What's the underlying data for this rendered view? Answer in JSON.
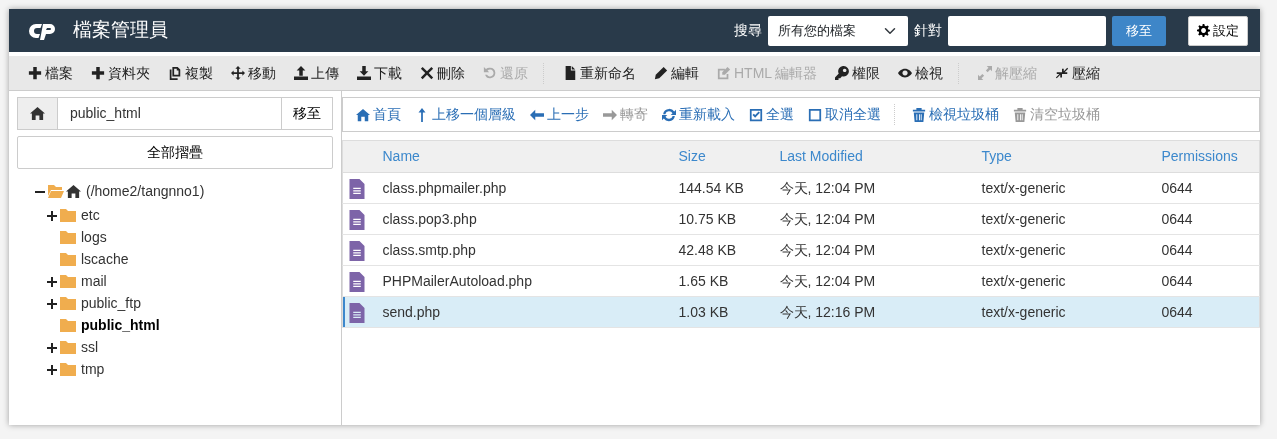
{
  "header": {
    "title": "檔案管理員",
    "search_label": "搜尋",
    "search_scope": "所有您的檔案",
    "for_label": "針對",
    "go_button": "移至",
    "settings_button": "設定"
  },
  "toolbar_groups": [
    [
      {
        "label": "檔案",
        "disabled": false
      },
      {
        "label": "資料夾",
        "disabled": false
      },
      {
        "label": "複製",
        "disabled": false
      },
      {
        "label": "移動",
        "disabled": false
      },
      {
        "label": "上傳",
        "disabled": false
      },
      {
        "label": "下載",
        "disabled": false
      },
      {
        "label": "刪除",
        "disabled": false
      },
      {
        "label": "還原",
        "disabled": true
      }
    ],
    [
      {
        "label": "重新命名",
        "disabled": false
      },
      {
        "label": "編輯",
        "disabled": false
      },
      {
        "label": "HTML 編輯器",
        "disabled": true
      },
      {
        "label": "權限",
        "disabled": false
      },
      {
        "label": "檢視",
        "disabled": false
      }
    ],
    [
      {
        "label": "解壓縮",
        "disabled": true
      },
      {
        "label": "壓縮",
        "disabled": false
      }
    ]
  ],
  "path_bar": {
    "value": "public_html",
    "go_button": "移至"
  },
  "collapse_button": "全部摺疊",
  "tree": [
    {
      "label": "(/home2/tangnno1)",
      "expanded": true,
      "children": [
        {
          "label": "etc",
          "has_children": true,
          "selected": false
        },
        {
          "label": "logs",
          "has_children": false,
          "selected": false
        },
        {
          "label": "lscache",
          "has_children": false,
          "selected": false
        },
        {
          "label": "mail",
          "has_children": true,
          "selected": false
        },
        {
          "label": "public_ftp",
          "has_children": true,
          "selected": false
        },
        {
          "label": "public_html",
          "has_children": false,
          "selected": true
        },
        {
          "label": "ssl",
          "has_children": true,
          "selected": false
        },
        {
          "label": "tmp",
          "has_children": true,
          "selected": false
        }
      ]
    }
  ],
  "nav_groups": [
    [
      {
        "label": "首頁",
        "disabled": false
      },
      {
        "label": "上移一個層級",
        "disabled": false
      },
      {
        "label": "上一步",
        "disabled": false
      },
      {
        "label": "轉寄",
        "disabled": true
      },
      {
        "label": "重新載入",
        "disabled": false
      },
      {
        "label": "全選",
        "disabled": false
      },
      {
        "label": "取消全選",
        "disabled": false
      }
    ],
    [
      {
        "label": "檢視垃圾桶",
        "disabled": false
      },
      {
        "label": "清空垃圾桶",
        "disabled": true
      }
    ]
  ],
  "table": {
    "columns": [
      "Name",
      "Size",
      "Last Modified",
      "Type",
      "Permissions"
    ],
    "rows": [
      {
        "cells": [
          "class.phpmailer.php",
          "144.54 KB",
          "今天, 12:04 PM",
          "text/x-generic",
          "0644"
        ],
        "selected": false
      },
      {
        "cells": [
          "class.pop3.php",
          "10.75 KB",
          "今天, 12:04 PM",
          "text/x-generic",
          "0644"
        ],
        "selected": false
      },
      {
        "cells": [
          "class.smtp.php",
          "42.48 KB",
          "今天, 12:04 PM",
          "text/x-generic",
          "0644"
        ],
        "selected": false
      },
      {
        "cells": [
          "PHPMailerAutoload.php",
          "1.65 KB",
          "今天, 12:04 PM",
          "text/x-generic",
          "0644"
        ],
        "selected": false
      },
      {
        "cells": [
          "send.php",
          "1.03 KB",
          "今天, 12:16 PM",
          "text/x-generic",
          "0644"
        ],
        "selected": true
      }
    ]
  }
}
